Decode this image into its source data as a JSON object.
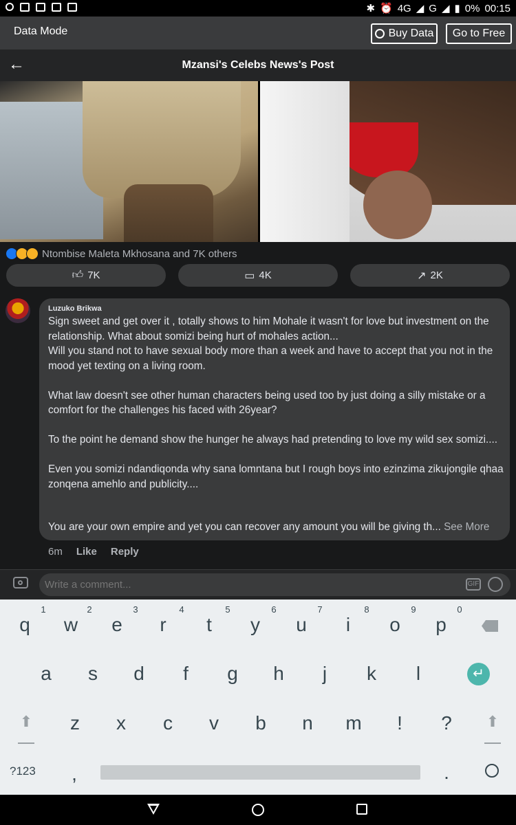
{
  "status_bar": {
    "network": "4G",
    "network_small": "4G",
    "network2": "G",
    "battery": "0%",
    "time": "00:15"
  },
  "data_bar": {
    "mode_label": "Data Mode",
    "buy_label": "Buy Data",
    "free_label": "Go to Free"
  },
  "header": {
    "title": "Mzansi's Celebs News's Post"
  },
  "post": {
    "reactions_text": "Ntombise Maleta Mkhosana and 7K others",
    "like_count": "7K",
    "comment_count": "4K",
    "share_count": "2K"
  },
  "comment": {
    "author": "Luzuko Brikwa",
    "paragraphs": [
      "Sign sweet and get over it , totally shows to him Mohale it wasn't for love but investment on the relationship. What about somizi being hurt of mohales action...\nWill you stand not to have sexual body more than a week and have to accept that you not in the mood yet texting on a living room.",
      "What law doesn't see other human characters being used too by just doing a silly mistake or a comfort for the challenges his faced with 26year?",
      "To the point he demand show the hunger he always had pretending to love my wild sex somizi....",
      "Even you somizi ndandiqonda why sana lomntana but I rough boys into ezinzima zikujongile qhaa zonqena amehlo and publicity...."
    ],
    "last_line": "You are your own empire and yet you can recover any amount you will be giving th...",
    "see_more": "See More",
    "time": "6m",
    "like": "Like",
    "reply": "Reply"
  },
  "composer": {
    "placeholder": "Write a comment...",
    "gif_label": "GIF"
  },
  "keyboard": {
    "numbers": [
      "1",
      "2",
      "3",
      "4",
      "5",
      "6",
      "7",
      "8",
      "9",
      "0"
    ],
    "row1": [
      "q",
      "w",
      "e",
      "r",
      "t",
      "y",
      "u",
      "i",
      "o",
      "p"
    ],
    "row2": [
      "a",
      "s",
      "d",
      "f",
      "g",
      "h",
      "j",
      "k",
      "l"
    ],
    "row3": [
      "z",
      "x",
      "c",
      "v",
      "b",
      "n",
      "m",
      "!",
      "?"
    ],
    "symbols_key": "?123",
    "comma": ",",
    "period": "."
  },
  "colors": {
    "accent": "#4db6ac",
    "bubble": "#3a3b3c",
    "page": "#18191a"
  }
}
